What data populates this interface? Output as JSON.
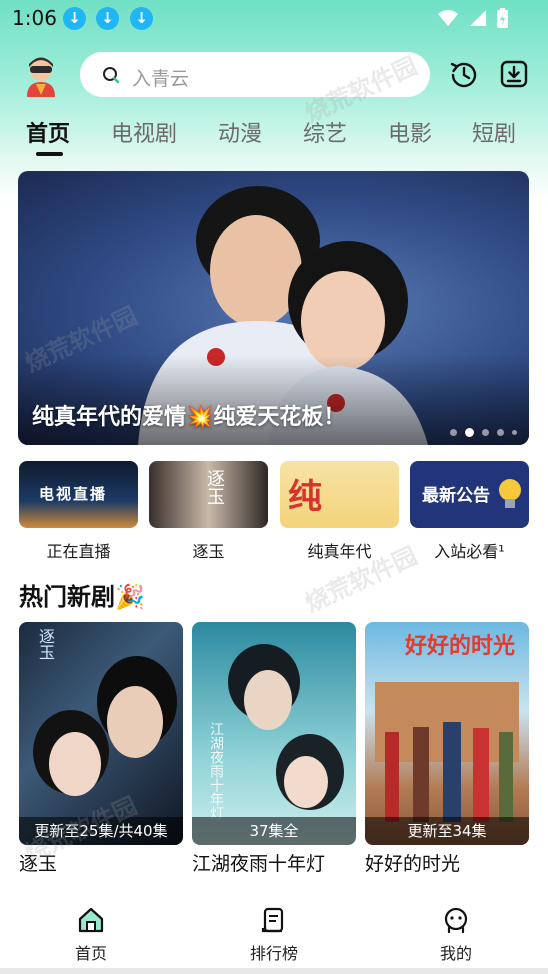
{
  "status_bar": {
    "time": "1:06",
    "download_badges": [
      "download-icon",
      "download-icon",
      "download-icon"
    ]
  },
  "search": {
    "placeholder": "入青云"
  },
  "tabs": [
    {
      "label": "首页",
      "active": true
    },
    {
      "label": "电视剧",
      "active": false
    },
    {
      "label": "动漫",
      "active": false
    },
    {
      "label": "综艺",
      "active": false
    },
    {
      "label": "电影",
      "active": false
    },
    {
      "label": "短剧",
      "active": false
    }
  ],
  "banner": {
    "caption": "纯真年代的爱情💥纯爱天花板！",
    "slide_count": 5,
    "active_slide": 2
  },
  "shortcuts": [
    {
      "label": "正在直播",
      "thumb_text": "电视直播"
    },
    {
      "label": "逐玉",
      "thumb_text": "逐玉"
    },
    {
      "label": "纯真年代",
      "thumb_text": "纯爱"
    },
    {
      "label": "入站必看¹",
      "thumb_text": "最新公告"
    }
  ],
  "section": {
    "title": "热门新剧🎉"
  },
  "cards": [
    {
      "title": "逐玉",
      "badge": "更新至25集/共40集",
      "poster_text": "逐玉"
    },
    {
      "title": "江湖夜雨十年灯",
      "badge": "37集全",
      "poster_text": "江湖夜雨十年灯"
    },
    {
      "title": "好好的时光",
      "badge": "更新至34集",
      "poster_text": "好好的时光"
    }
  ],
  "bottom_nav": [
    {
      "label": "首页",
      "icon": "home-icon",
      "active": true
    },
    {
      "label": "排行榜",
      "icon": "ranking-icon",
      "active": false
    },
    {
      "label": "我的",
      "icon": "profile-icon",
      "active": false
    }
  ],
  "watermark": "烧荒软件园",
  "colors": {
    "accent": "#6fe0c4",
    "download_badge": "#1fb6f3",
    "text": "#111111"
  }
}
